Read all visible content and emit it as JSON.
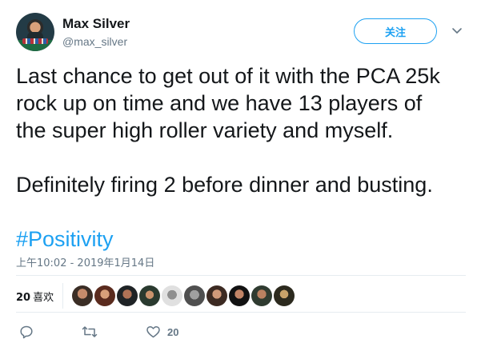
{
  "author": {
    "name": "Max Silver",
    "handle": "@max_silver",
    "follow_label": "关注"
  },
  "tweet": {
    "lines": [
      "Last chance to get out of it with the PCA 25k",
      "rock up on time and we have 13 players of",
      "the super high roller variety and myself.",
      "Definitely firing 2 before dinner and busting."
    ],
    "hashtag": "#Positivity",
    "timestamp": "上午10:02 - 2019年1月14日"
  },
  "stats": {
    "likes_count": "20",
    "likes_label": "喜欢"
  },
  "actions": {
    "reply_count": "",
    "retweet_count": "",
    "like_count": "20"
  },
  "colors": {
    "accent": "#1da1f2",
    "secondary_text": "#657786",
    "divider": "#e6ecf0"
  },
  "icons": [
    "chevron-down-icon",
    "reply-icon",
    "retweet-icon",
    "heart-icon"
  ]
}
